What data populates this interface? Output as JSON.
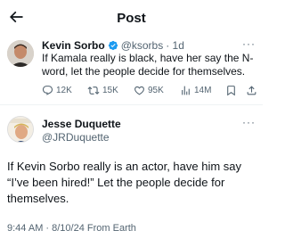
{
  "header": {
    "title": "Post",
    "back_icon": "arrow-left-icon"
  },
  "reply_tweet": {
    "name": "Kevin Sorbo",
    "handle": "@ksorbs",
    "time": "· 1d",
    "text": "If Kamala really is black, have her say the N-word, let the people decide for themselves.",
    "replies": "12K",
    "reposts": "15K",
    "likes": "95K",
    "views": "14M"
  },
  "main_tweet": {
    "name": "Jesse Duquette",
    "handle": "@JRDuquette",
    "text": "If Kevin Sorbo really is an actor, have him say “I’ve been hired!” Let the people decide for themselves.",
    "meta": "9:44 AM · 8/10/24 From Earth"
  },
  "colors": {
    "verified": "#1d9bf0",
    "muted": "#536471",
    "text": "#0f1419"
  }
}
